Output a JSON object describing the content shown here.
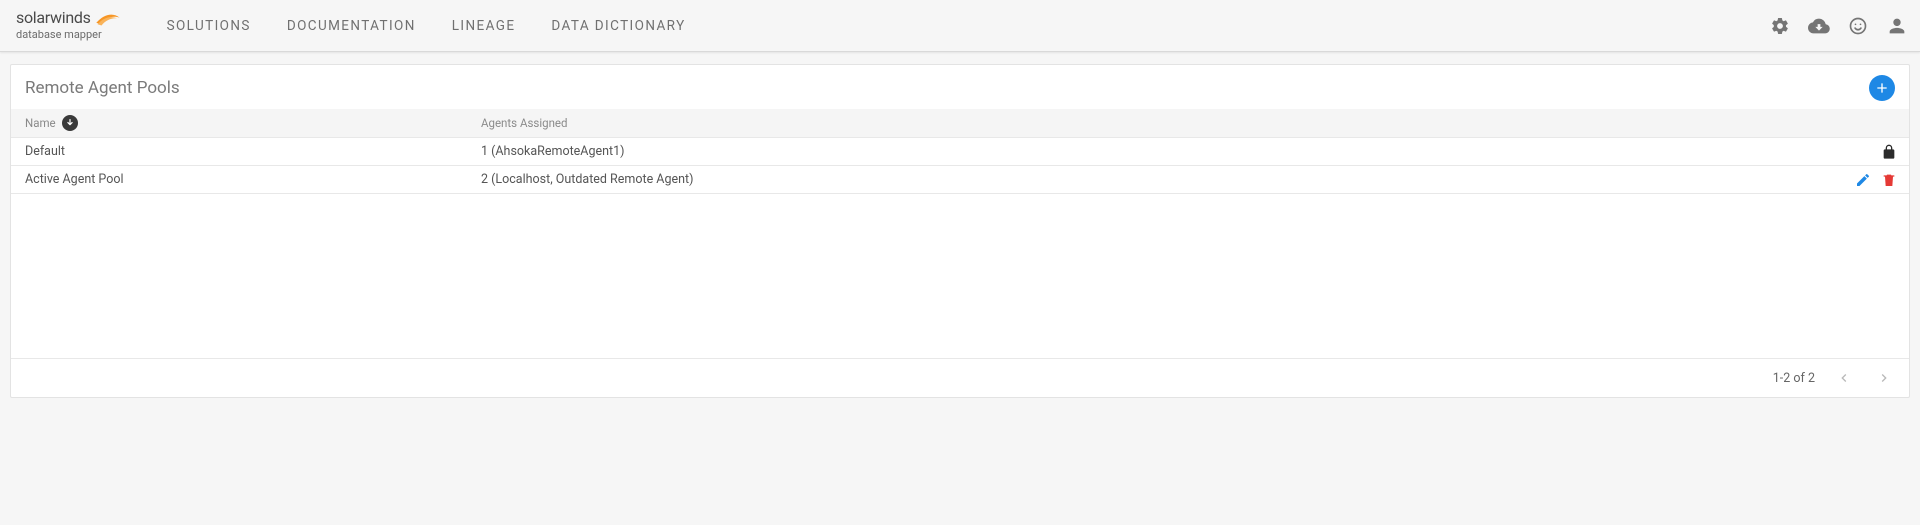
{
  "brand": {
    "name": "solarwinds",
    "product": "database mapper"
  },
  "nav": {
    "solutions": "SOLUTIONS",
    "documentation": "DOCUMENTATION",
    "lineage": "LINEAGE",
    "dataDictionary": "DATA DICTIONARY"
  },
  "page": {
    "title": "Remote Agent Pools"
  },
  "table": {
    "headers": {
      "name": "Name",
      "agents": "Agents Assigned"
    },
    "rows": [
      {
        "name": "Default",
        "agents": "1 (AhsokaRemoteAgent1)",
        "locked": true
      },
      {
        "name": "Active Agent Pool",
        "agents": "2 (Localhost, Outdated Remote Agent)",
        "locked": false
      }
    ]
  },
  "pagination": {
    "summary": "1-2 of 2"
  }
}
